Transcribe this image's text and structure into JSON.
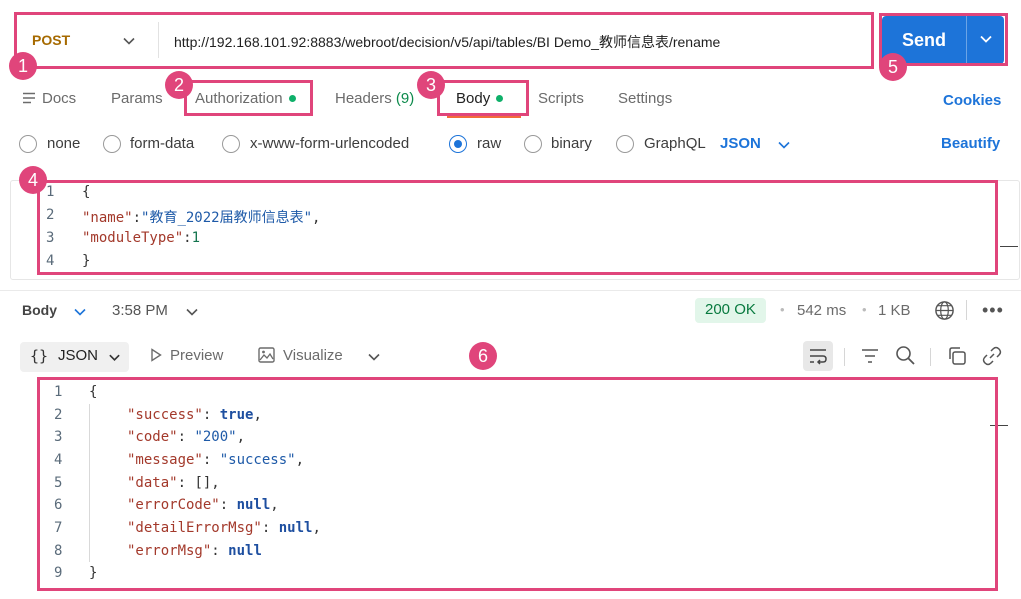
{
  "request": {
    "method": "POST",
    "url": "http://192.168.101.92:8883/webroot/decision/v5/api/tables/BI Demo_教师信息表/rename",
    "send_label": "Send"
  },
  "tabs": [
    {
      "label": "Docs"
    },
    {
      "label": "Params"
    },
    {
      "label": "Authorization"
    },
    {
      "label": "Headers",
      "count": "(9)"
    },
    {
      "label": "Body"
    },
    {
      "label": "Scripts"
    },
    {
      "label": "Settings"
    }
  ],
  "cookies_label": "Cookies",
  "body_types": [
    {
      "label": "none"
    },
    {
      "label": "form-data"
    },
    {
      "label": "x-www-form-urlencoded"
    },
    {
      "label": "raw",
      "selected": true
    },
    {
      "label": "binary"
    },
    {
      "label": "GraphQL"
    }
  ],
  "language": "JSON",
  "beautify_label": "Beautify",
  "request_body": {
    "line_numbers": [
      "1",
      "2",
      "3",
      "4"
    ],
    "open": "{",
    "name_key": "\"name\"",
    "name_value": "\"教育_2022届教师信息表\"",
    "module_key": "\"moduleType\"",
    "module_value": "1",
    "close": "}"
  },
  "response": {
    "body_label": "Body",
    "time": "3:58 PM",
    "status": "200 OK",
    "duration": "542 ms",
    "size": "1 KB",
    "format": "JSON",
    "preview_label": "Preview",
    "visualize_label": "Visualize",
    "line_numbers": [
      "1",
      "2",
      "3",
      "4",
      "5",
      "6",
      "7",
      "8",
      "9"
    ],
    "lines": [
      {
        "key": "\"success\"",
        "value": "true",
        "type": "bool"
      },
      {
        "key": "\"code\"",
        "value": "\"200\"",
        "type": "str"
      },
      {
        "key": "\"message\"",
        "value": "\"success\"",
        "type": "str"
      },
      {
        "key": "\"data\"",
        "value": "[]",
        "type": "punct"
      },
      {
        "key": "\"errorCode\"",
        "value": "null",
        "type": "bool"
      },
      {
        "key": "\"detailErrorMsg\"",
        "value": "null",
        "type": "bool"
      },
      {
        "key": "\"errorMsg\"",
        "value": "null",
        "type": "bool",
        "last": true
      }
    ]
  },
  "annotations": [
    "1",
    "2",
    "3",
    "4",
    "5",
    "6"
  ],
  "colors": {
    "accent": "#1d74d9",
    "highlight": "#e0457b",
    "success": "#0fb06a",
    "method": "#a66a00"
  },
  "icons": [
    "chevron-down-icon",
    "docs-icon",
    "play-icon",
    "image-icon",
    "wrap-icon",
    "filter-icon",
    "search-icon",
    "copy-icon",
    "link-icon",
    "globe-icon",
    "more-icon"
  ]
}
